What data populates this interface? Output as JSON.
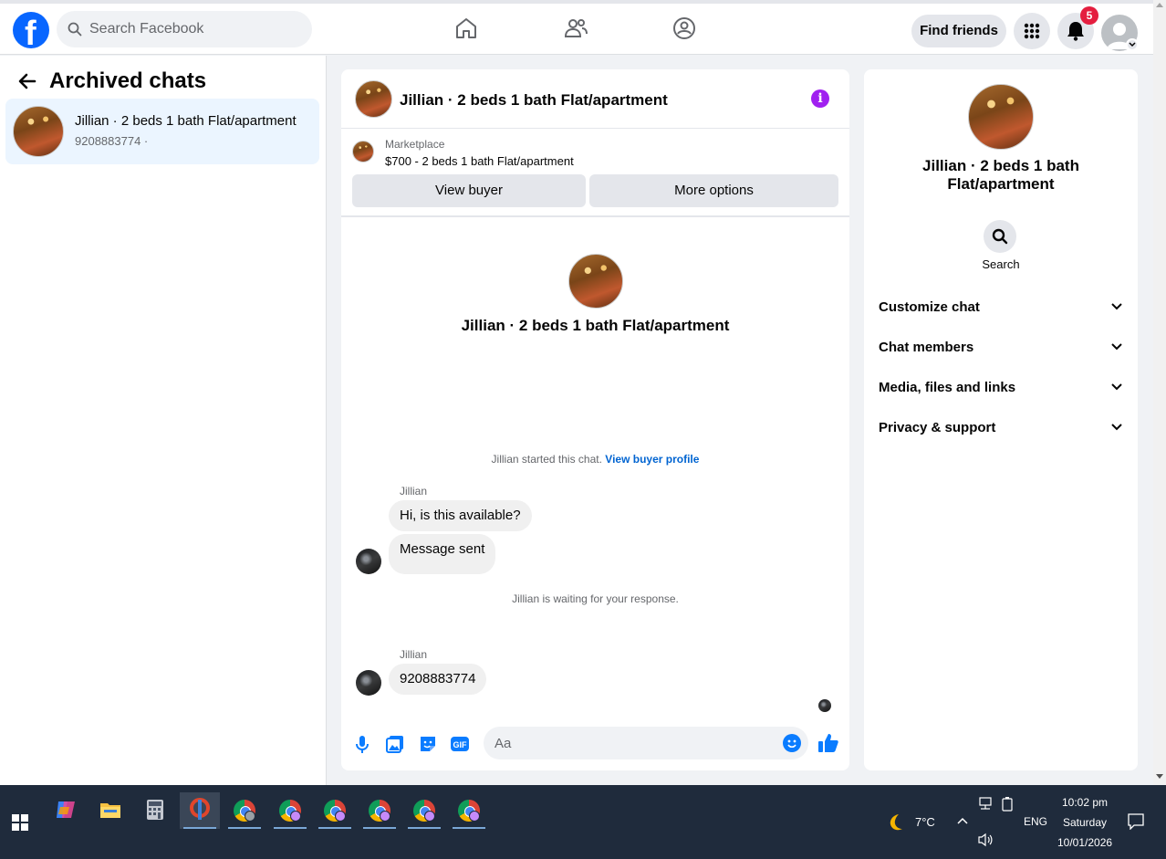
{
  "topbar": {
    "search_placeholder": "Search Facebook",
    "find_friends": "Find friends",
    "notification_count": "5"
  },
  "left": {
    "title": "Archived chats",
    "chat": {
      "name": "Jillian · 2 beds 1 bath Flat/apartment",
      "sub": "9208883774 ·"
    }
  },
  "conversation": {
    "title": "Jillian · 2 beds 1 bath Flat/apartment",
    "marketplace_label": "Marketplace",
    "listing": "$700 - 2 beds 1 bath Flat/apartment",
    "view_buyer": "View buyer",
    "more_options": "More options",
    "hero_title": "Jillian · 2 beds 1 bath Flat/apartment",
    "started_text": "Jillian started this chat.",
    "view_buyer_profile": "View buyer profile",
    "messages": [
      {
        "sender": "Jillian",
        "text": "Hi, is this available?"
      },
      {
        "text": "Message sent"
      },
      {
        "sender": "Jillian",
        "text": "9208883774"
      }
    ],
    "waiting_text": "Jillian is waiting for your response.",
    "input_placeholder": "Aa"
  },
  "details": {
    "title": "Jillian · 2 beds 1 bath Flat/apartment",
    "search_label": "Search",
    "sections": [
      "Customize chat",
      "Chat members",
      "Media, files and links",
      "Privacy & support"
    ]
  },
  "taskbar": {
    "weather": "7°C",
    "lang": "ENG",
    "time": "10:02 pm",
    "day": "Saturday",
    "date": "10/01/2026"
  },
  "colors": {
    "brand": "#0866ff",
    "accent_purple": "#a020f0",
    "link": "#0064d1",
    "badge": "#e41e3f"
  },
  "icons": [
    "home-icon",
    "friends-icon",
    "groups-icon",
    "menu-grid-icon",
    "bell-icon",
    "search-icon",
    "info-icon",
    "mic-icon",
    "image-icon",
    "sticker-icon",
    "gif-icon",
    "emoji-icon",
    "like-icon"
  ]
}
